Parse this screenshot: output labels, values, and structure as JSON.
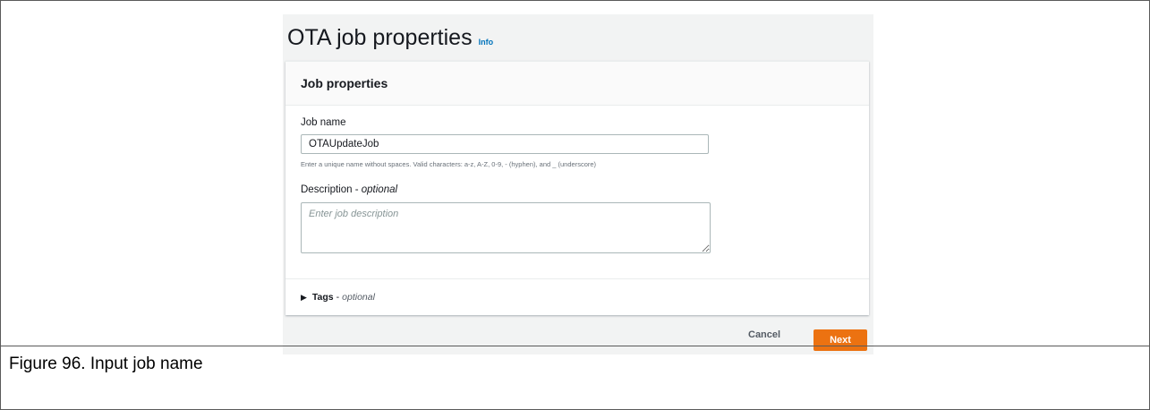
{
  "header": {
    "title": "OTA job properties",
    "info": "Info"
  },
  "panel": {
    "title": "Job properties",
    "job_name_label": "Job name",
    "job_name_value": "OTAUpdateJob",
    "job_name_hint": "Enter a unique name without spaces. Valid characters: a-z, A-Z, 0-9, - (hyphen), and _ (underscore)",
    "description_label": "Description",
    "description_label_sep": " - ",
    "description_optional": "optional",
    "description_placeholder": "Enter job description",
    "tags_label": "Tags",
    "tags_sep": "-",
    "tags_optional": "optional"
  },
  "footer": {
    "cancel_label": "Cancel",
    "next_label": "Next"
  },
  "caption": "Figure 96.  Input job name",
  "colors": {
    "primary_button": "#ec7211",
    "link": "#0073bb"
  }
}
